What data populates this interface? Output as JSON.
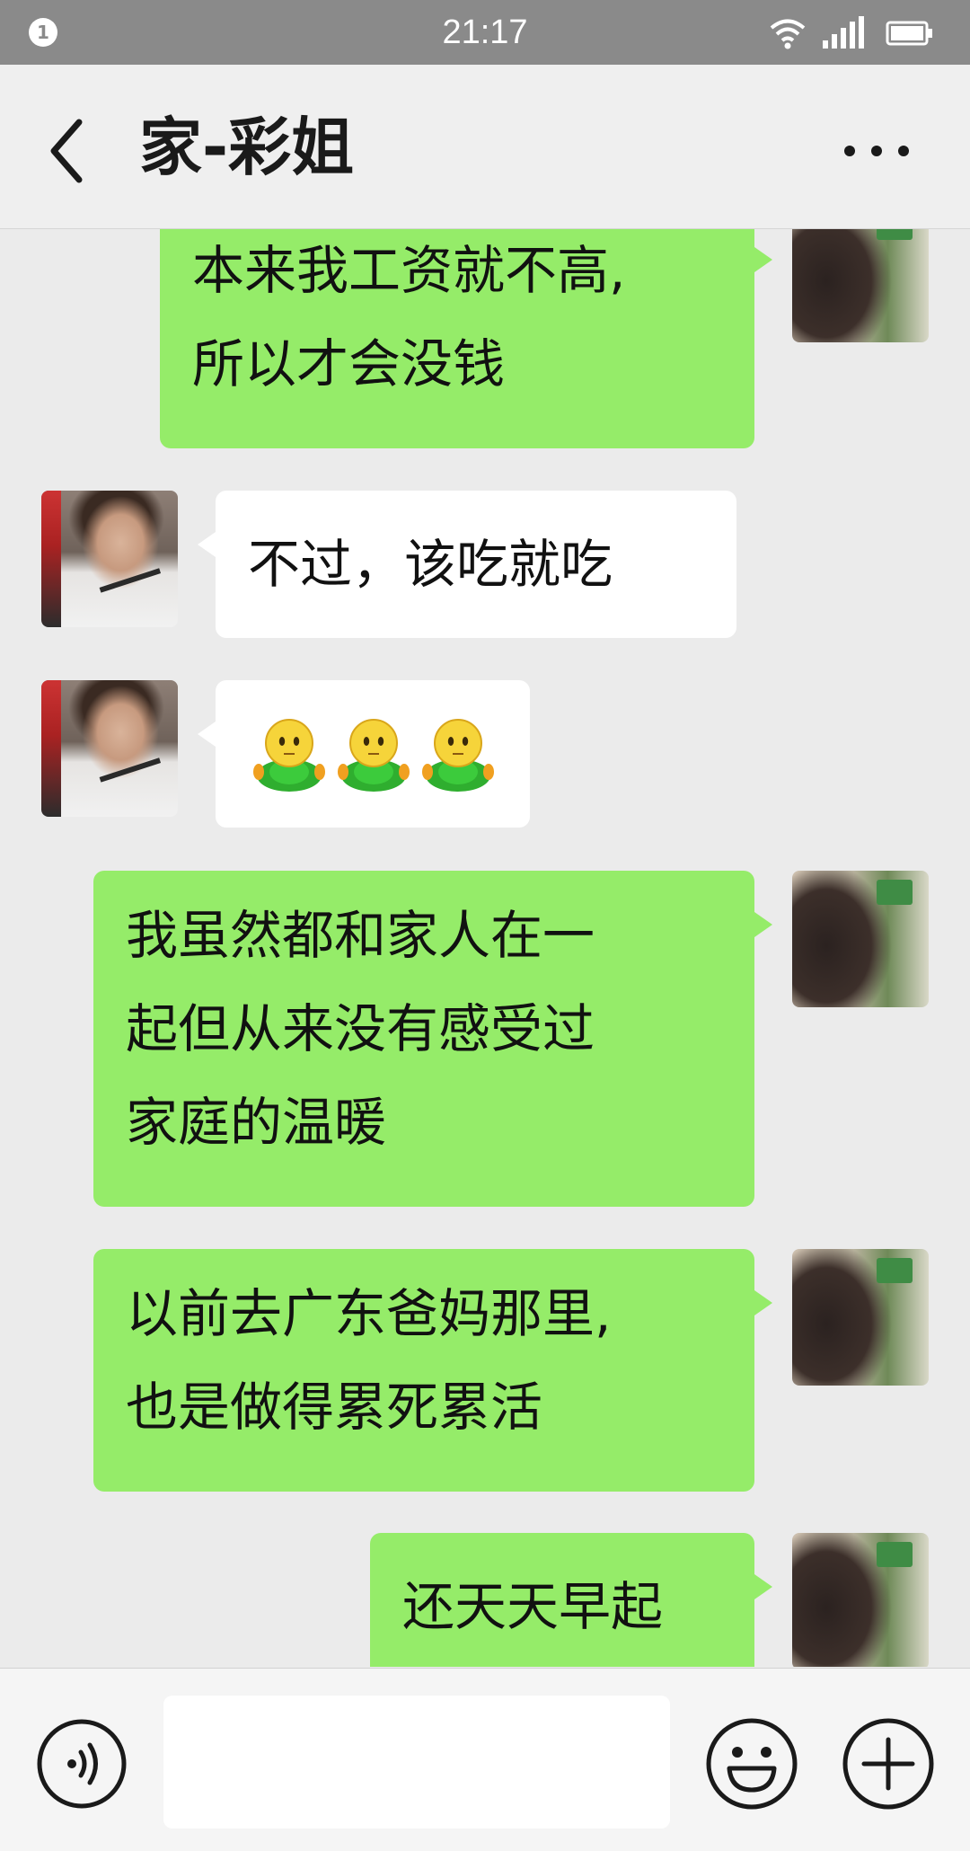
{
  "status_bar": {
    "notification_count": "1",
    "time": "21:17",
    "icons": [
      "wifi-icon",
      "signal-icon",
      "battery-icon"
    ]
  },
  "header": {
    "title": "家-彩姐",
    "back_icon": "chevron-left-icon",
    "more_icon": "more-dots-icon"
  },
  "messages": [
    {
      "sender": "self",
      "lines": [
        "本来我工资就不高,",
        "所以才会没钱"
      ]
    },
    {
      "sender": "other",
      "lines": [
        "不过，该吃就吃"
      ]
    },
    {
      "sender": "other",
      "type": "emoji",
      "emojis": [
        "sprout-emoji",
        "sprout-emoji",
        "sprout-emoji"
      ]
    },
    {
      "sender": "self",
      "lines": [
        "我虽然都和家人在一",
        "起但从来没有感受过",
        "家庭的温暖"
      ]
    },
    {
      "sender": "self",
      "lines": [
        "以前去广东爸妈那里,",
        "也是做得累死累活"
      ]
    },
    {
      "sender": "self",
      "lines": [
        "还天天早起"
      ]
    }
  ],
  "input_bar": {
    "voice_icon": "voice-icon",
    "message_value": "",
    "emoji_icon": "smiley-icon",
    "plus_icon": "plus-icon"
  },
  "colors": {
    "status_bar_bg": "#8a8a8a",
    "chat_bg": "#ebebeb",
    "self_bubble": "#95ec69",
    "other_bubble": "#ffffff"
  }
}
